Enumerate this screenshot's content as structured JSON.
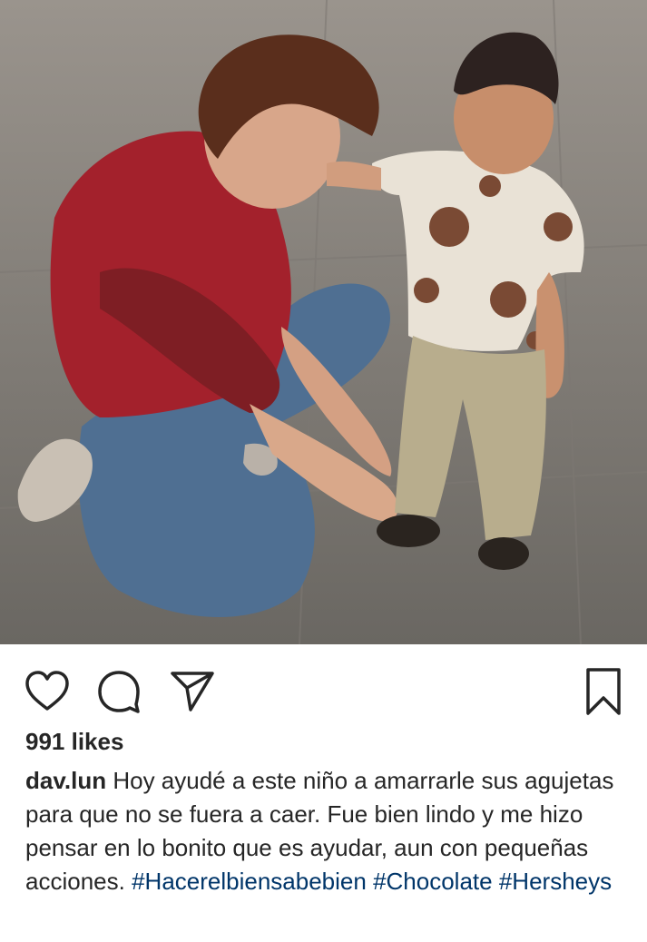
{
  "post": {
    "photo_alt": "",
    "likes": "991 likes",
    "username": "dav.lun",
    "caption_text": "Hoy ayudé a este niño a amarrarle sus agujetas para que no se fuera a caer. Fue bien lindo y me hizo pensar en lo bonito que es ayudar, aun con pequeñas acciones.",
    "hashtags": [
      "#Hacerelbiensabebien",
      "#Chocolate",
      "#Hersheys"
    ]
  },
  "icons": {
    "like": "heart-icon",
    "comment": "comment-bubble-icon",
    "share": "paper-plane-icon",
    "save": "bookmark-icon"
  },
  "colors": {
    "text": "#262626",
    "hashtag": "#003569",
    "background": "#ffffff"
  }
}
